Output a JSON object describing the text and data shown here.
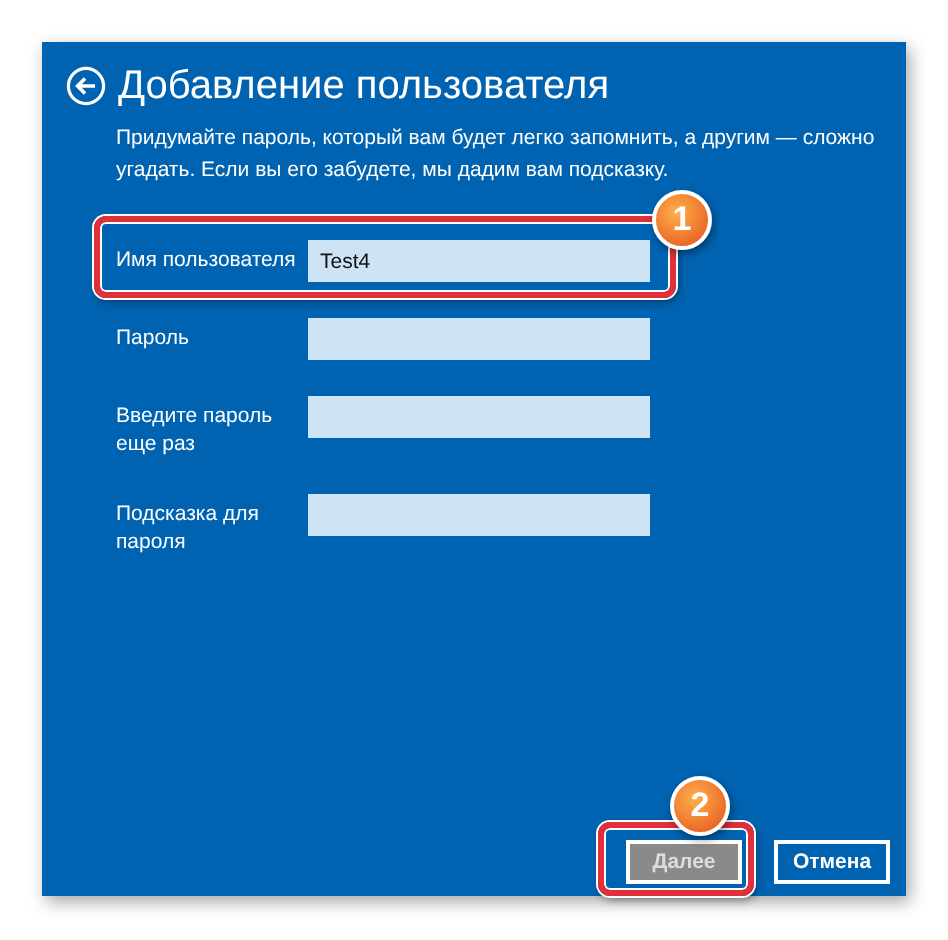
{
  "title": "Добавление пользователя",
  "description": "Придумайте пароль, который вам будет легко запомнить, а другим — сложно угадать. Если вы его забудете, мы дадим вам подсказку.",
  "fields": [
    {
      "label": "Имя пользователя",
      "value": "Test4",
      "callout": "1"
    },
    {
      "label": "Пароль"
    },
    {
      "label": "Введите пароль еще раз"
    },
    {
      "label": "Подсказка для пароля"
    }
  ],
  "buttons": [
    {
      "label": "Далее",
      "disabled": true,
      "callout": "2"
    },
    {
      "label": "Отмена",
      "disabled": false
    }
  ]
}
